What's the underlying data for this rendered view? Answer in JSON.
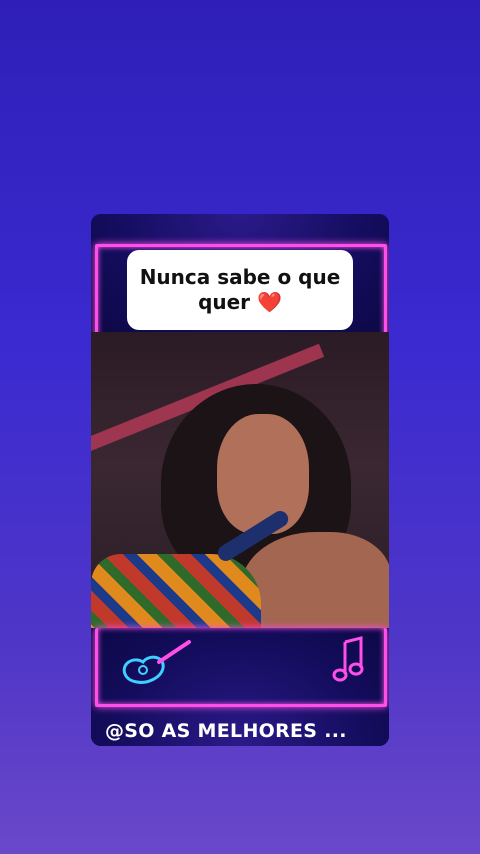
{
  "caption": {
    "text": "Nunca sabe o que quer",
    "emoji": "❤️"
  },
  "footer": {
    "handle": "@SO AS MELHORES ..."
  },
  "icons": {
    "top_decoration": "neon-frame",
    "bottom_left": "guitar-icon",
    "bottom_right": "music-note-icon"
  },
  "colors": {
    "neon": "#ff4fe8",
    "background_top": "#2f1fb8",
    "background_bottom": "#6a48c9"
  }
}
